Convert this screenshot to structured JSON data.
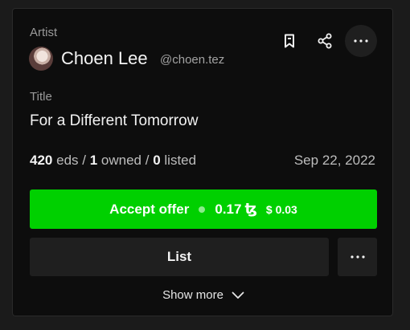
{
  "artist": {
    "label": "Artist",
    "name": "Choen Lee",
    "handle": "@choen.tez"
  },
  "actions": {
    "bookmark_icon": "bookmark-icon",
    "share_icon": "share-icon",
    "more_icon": "ellipsis-icon"
  },
  "title": {
    "label": "Title",
    "value": "For a Different Tomorrow"
  },
  "stats": {
    "editions": "420",
    "editions_label": "eds",
    "owned": "1",
    "owned_label": "owned",
    "listed": "0",
    "listed_label": "listed",
    "date": "Sep 22, 2022"
  },
  "accept_offer": {
    "label": "Accept offer",
    "price": "0.17",
    "currency_symbol": "ꜩ",
    "usd": "$ 0.03",
    "color": "#00d000"
  },
  "list_button": {
    "label": "List"
  },
  "show_more": {
    "label": "Show more"
  }
}
